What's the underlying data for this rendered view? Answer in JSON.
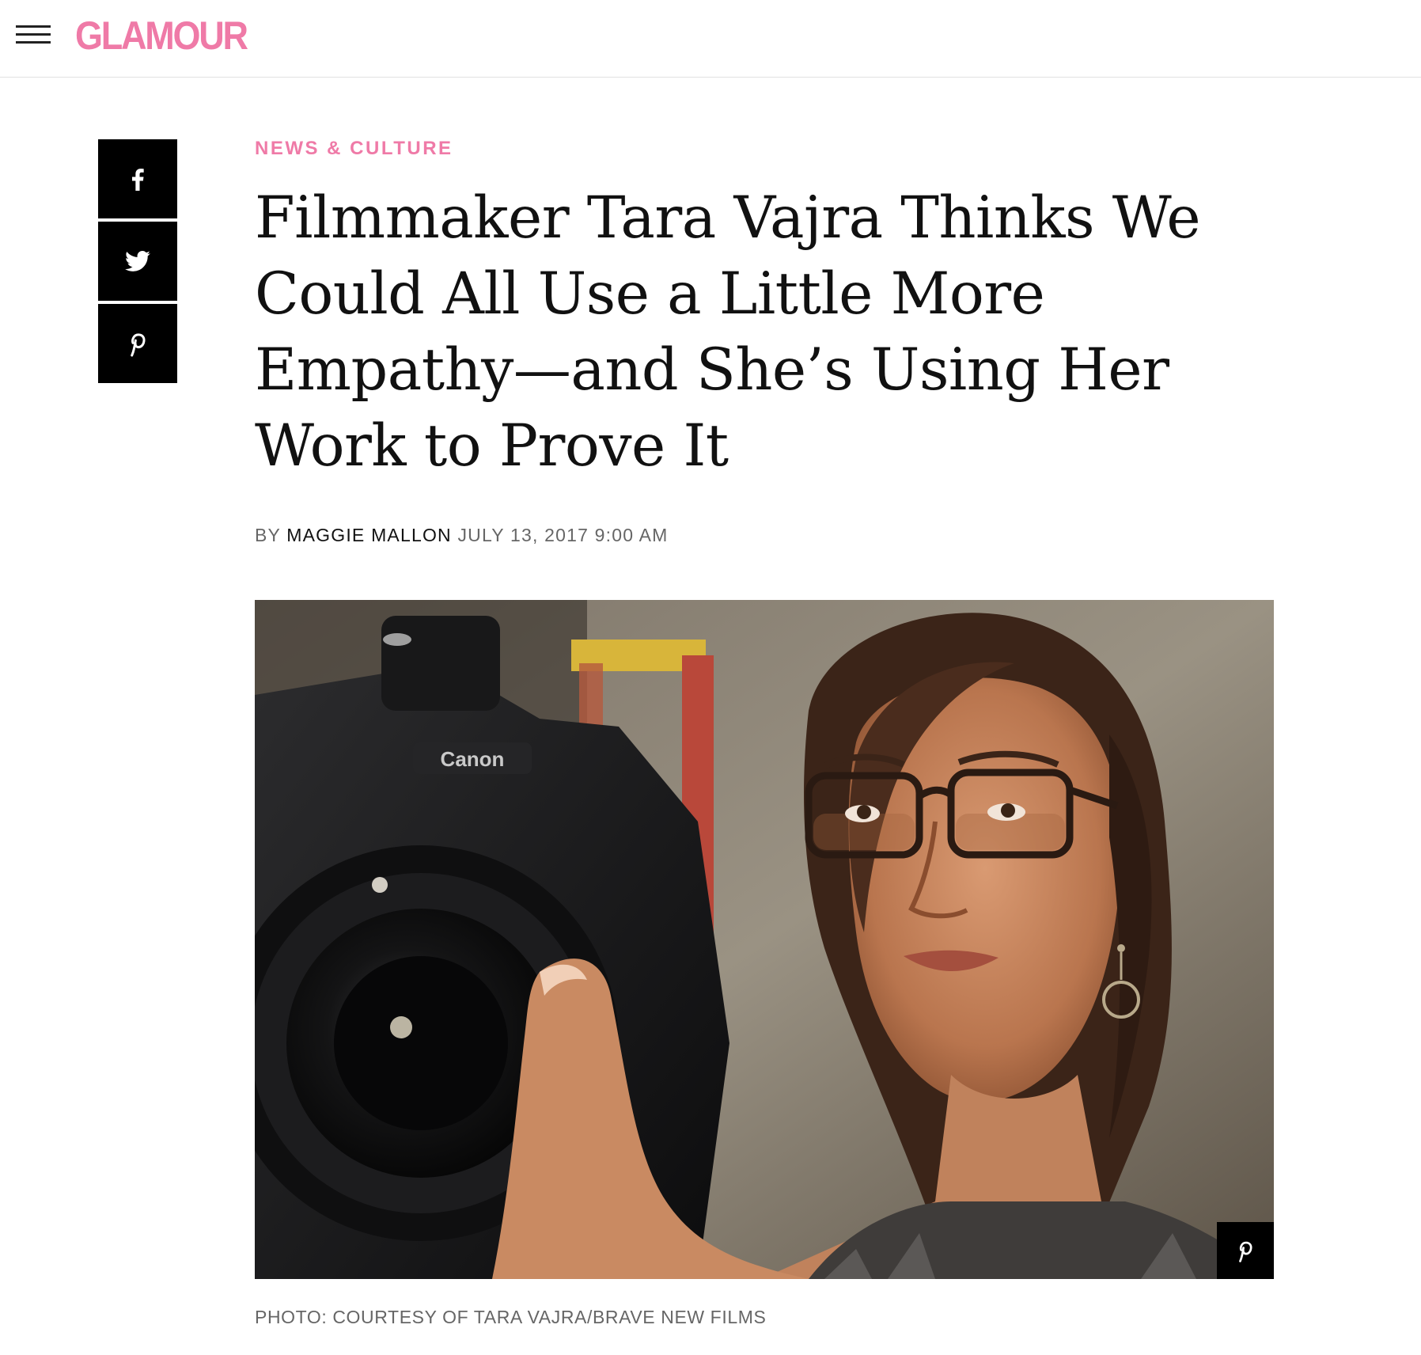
{
  "header": {
    "logo_text": "GLAMOUR",
    "menu_icon": "hamburger-menu-icon",
    "brand_color": "#ef7aa7"
  },
  "share": {
    "items": [
      {
        "network": "facebook",
        "icon": "facebook-icon"
      },
      {
        "network": "twitter",
        "icon": "twitter-icon"
      },
      {
        "network": "pinterest",
        "icon": "pinterest-icon"
      }
    ]
  },
  "article": {
    "section": "NEWS & CULTURE",
    "headline": "Filmmaker Tara Vajra Thinks We Could All Use a Little More Empathy—and She’s Using Her Work to Prove It",
    "byline_prefix": "BY",
    "author": "MAGGIE MALLON",
    "date": "JULY 13, 2017 9:00 AM",
    "image_alt": "Woman with glasses holding a Canon camera",
    "caption": "PHOTO: COURTESY OF TARA VAJRA/BRAVE NEW FILMS",
    "image_pin_icon": "pinterest-icon"
  },
  "colors": {
    "accent": "#ef7aa7",
    "text": "#111111",
    "muted": "#666666",
    "share_bg": "#000000"
  }
}
